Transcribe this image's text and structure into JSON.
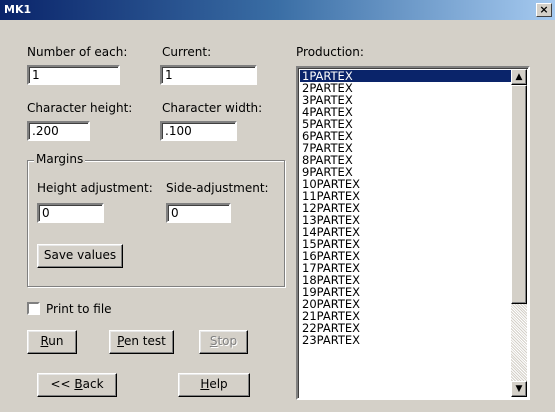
{
  "window": {
    "title": "MK1",
    "close_glyph": "×"
  },
  "fields": {
    "number_of_each": {
      "label": "Number of each:",
      "value": "1"
    },
    "current": {
      "label": "Current:",
      "value": "1"
    },
    "character_height": {
      "label": "Character height:",
      "value": ".200"
    },
    "character_width": {
      "label": "Character width:",
      "value": ".100"
    }
  },
  "margins": {
    "legend": "Margins",
    "height_adjustment": {
      "label": "Height adjustment:",
      "value": "0"
    },
    "side_adjustment": {
      "label": "Side-adjustment:",
      "value": "0"
    },
    "save_label": "Save values"
  },
  "print_to_file": {
    "label": "Print to file",
    "checked": false
  },
  "buttons": {
    "run": {
      "mnemonic": "R",
      "rest": "un"
    },
    "pen_test": {
      "mnemonic": "P",
      "rest": "en test"
    },
    "stop": {
      "mnemonic": "S",
      "rest": "top"
    },
    "back": {
      "prefix": "<< ",
      "mnemonic": "B",
      "rest": "ack"
    },
    "help": {
      "mnemonic": "H",
      "rest": "elp"
    }
  },
  "production": {
    "label": "Production:",
    "selected_index": 0,
    "items": [
      "1PARTEX",
      "2PARTEX",
      "3PARTEX",
      "4PARTEX",
      "5PARTEX",
      "6PARTEX",
      "7PARTEX",
      "8PARTEX",
      "9PARTEX",
      "10PARTEX",
      "11PARTEX",
      "12PARTEX",
      "13PARTEX",
      "14PARTEX",
      "15PARTEX",
      "16PARTEX",
      "17PARTEX",
      "18PARTEX",
      "19PARTEX",
      "20PARTEX",
      "21PARTEX",
      "22PARTEX",
      "23PARTEX"
    ]
  },
  "icons": {
    "close": "close-icon",
    "scroll_up": "arrow-up-icon",
    "scroll_down": "arrow-down-icon"
  },
  "colors": {
    "face": "#d4d0c8",
    "title_start": "#0a246a",
    "title_end": "#a6caf0",
    "selection": "#0a246a"
  }
}
